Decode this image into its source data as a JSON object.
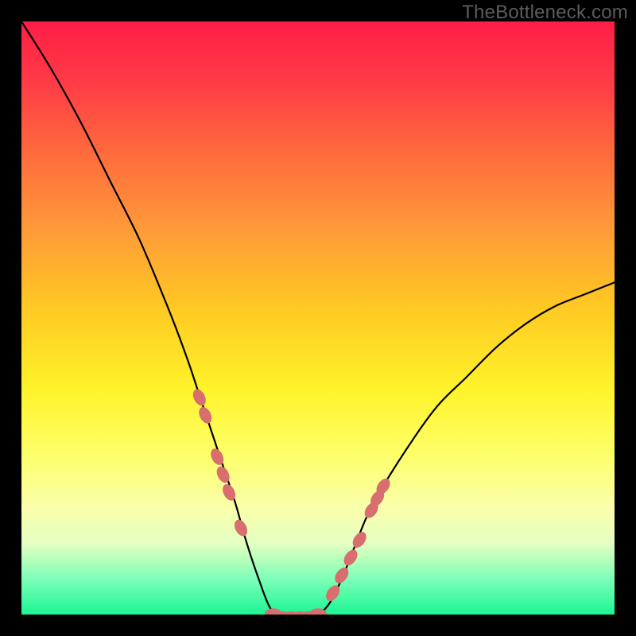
{
  "watermark": "TheBottleneck.com",
  "colors": {
    "frame": "#000000",
    "gradient_top": "#ff1e46",
    "gradient_mid": "#fff32a",
    "gradient_bottom": "#1cf594",
    "curve": "#000000",
    "marker": "#d86e6e"
  },
  "chart_data": {
    "type": "line",
    "title": "",
    "xlabel": "",
    "ylabel": "",
    "xlim": [
      0,
      100
    ],
    "ylim": [
      0,
      100
    ],
    "grid": false,
    "note": "V-shaped bottleneck curve. Y represents bottleneck severity (0=green/good, 100=red/severe). Minimum (flat zero region) around x≈43–50. Left branch rises to ~100 at x=0; right branch rises to ~56 at x=100.",
    "series": [
      {
        "name": "bottleneck-curve",
        "x": [
          0,
          5,
          10,
          15,
          20,
          25,
          28,
          30,
          32,
          34,
          36,
          38,
          40,
          42,
          44,
          46,
          48,
          50,
          52,
          54,
          56,
          58,
          60,
          65,
          70,
          75,
          80,
          85,
          90,
          95,
          100
        ],
        "values": [
          100,
          92,
          83,
          73,
          63,
          51,
          43,
          37,
          31,
          25,
          19,
          12,
          6,
          1,
          0,
          0,
          0,
          0,
          2,
          6,
          11,
          16,
          20,
          28,
          35,
          40,
          45,
          49,
          52,
          54,
          56
        ]
      }
    ],
    "markers": [
      {
        "name": "left-cluster",
        "points": [
          [
            30,
            37
          ],
          [
            31,
            34
          ],
          [
            33,
            27
          ],
          [
            34,
            24
          ],
          [
            35,
            21
          ],
          [
            37,
            15
          ]
        ]
      },
      {
        "name": "bottom-flat",
        "points": [
          [
            42.5,
            0.5
          ],
          [
            44,
            0
          ],
          [
            45.5,
            0
          ],
          [
            47,
            0
          ],
          [
            48.5,
            0
          ],
          [
            50,
            0.5
          ]
        ]
      },
      {
        "name": "right-cluster",
        "points": [
          [
            52.5,
            4
          ],
          [
            54,
            7
          ],
          [
            55.5,
            10
          ],
          [
            57,
            13
          ],
          [
            59,
            18
          ],
          [
            60,
            20
          ],
          [
            61,
            22
          ]
        ]
      }
    ]
  }
}
